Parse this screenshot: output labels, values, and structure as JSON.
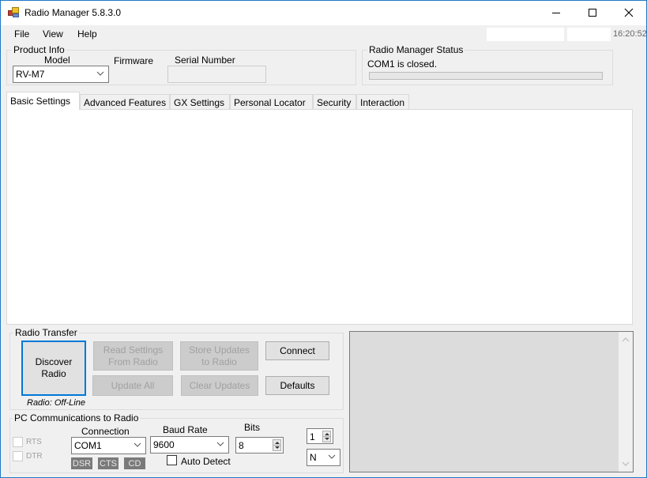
{
  "window": {
    "title": "Radio Manager  5.8.3.0",
    "controls": {
      "minimize": "minimize",
      "maximize": "maximize",
      "close": "close"
    }
  },
  "menu": {
    "items": [
      {
        "label": "File"
      },
      {
        "label": "View"
      },
      {
        "label": "Help"
      }
    ],
    "clock": "16:20:52"
  },
  "product_info": {
    "group_label": "Product Info",
    "model_label": "Model",
    "model_value": "RV-M7",
    "firmware_label": "Firmware",
    "serial_label": "Serial Number",
    "serial_value": ""
  },
  "status": {
    "group_label": "Radio Manager Status",
    "message": "COM1 is closed.",
    "progress": 0
  },
  "tabs": [
    {
      "label": "Basic Settings",
      "active": true
    },
    {
      "label": "Advanced Features",
      "active": false
    },
    {
      "label": "GX Settings",
      "active": false
    },
    {
      "label": "Personal Locator",
      "active": false
    },
    {
      "label": "Security",
      "active": false
    },
    {
      "label": "Interaction",
      "active": false
    }
  ],
  "radio_transfer": {
    "group_label": "Radio Transfer",
    "discover_label_1": "Discover",
    "discover_label_2": "Radio",
    "read_label_1": "Read Settings",
    "read_label_2": "From Radio",
    "store_label_1": "Store Updates",
    "store_label_2": "to Radio",
    "connect_label": "Connect",
    "update_all_label": "Update All",
    "clear_updates_label": "Clear Updates",
    "defaults_label": "Defaults",
    "radio_status": "Radio: Off-Line"
  },
  "pc_comm": {
    "group_label": "PC Communications to Radio",
    "rts_label": "RTS",
    "dtr_label": "DTR",
    "connection_label": "Connection",
    "connection_value": "COM1",
    "baud_label": "Baud Rate",
    "baud_value": "9600",
    "bits_label": "Bits",
    "bits_value": "8",
    "auto_detect_label": "Auto Detect",
    "auto_detect_checked": false,
    "stop_bits_value": "1",
    "parity_value": "N",
    "signals": [
      "DSR",
      "CTS",
      "CD"
    ]
  },
  "colors": {
    "accent": "#0078d7",
    "window_border": "#1f78c8"
  }
}
